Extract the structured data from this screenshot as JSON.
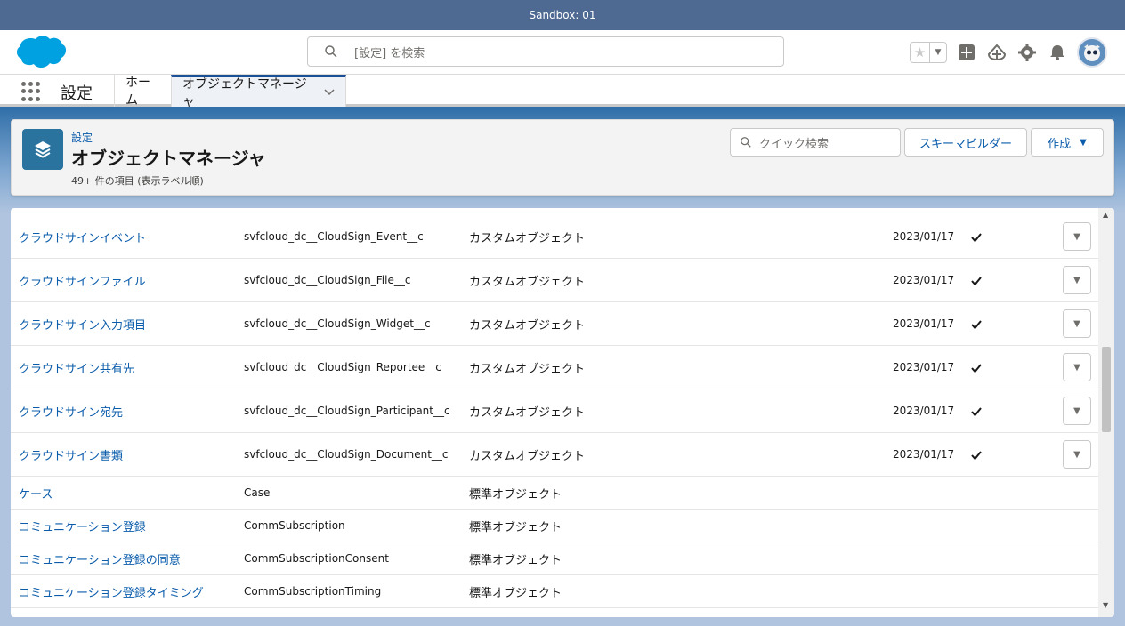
{
  "sandbox": {
    "label": "Sandbox: 01"
  },
  "header": {
    "search_placeholder": "[設定] を検索",
    "icons": [
      "salesforce-cloud-logo",
      "search-icon",
      "star-icon",
      "chevron-down-icon",
      "add-icon",
      "trailhead-icon",
      "gear-icon",
      "bell-icon",
      "avatar"
    ]
  },
  "nav": {
    "app_name": "設定",
    "tabs": [
      {
        "label": "ホーム"
      },
      {
        "label": "オブジェクトマネージャ"
      }
    ]
  },
  "page_header": {
    "breadcrumb": "設定",
    "title": "オブジェクトマネージャ",
    "count": "49+ 件の項目 (表示ラベル順)",
    "quick_search_placeholder": "クイック検索",
    "schema_builder_label": "スキーマビルダー",
    "create_label": "作成"
  },
  "rows": [
    {
      "label": "クラウドサインイベント",
      "api": "svfcloud_dc__CloudSign_Event__c",
      "type": "カスタムオブジェクト",
      "date": "2023/01/17",
      "deployed": true
    },
    {
      "label": "クラウドサインファイル",
      "api": "svfcloud_dc__CloudSign_File__c",
      "type": "カスタムオブジェクト",
      "date": "2023/01/17",
      "deployed": true
    },
    {
      "label": "クラウドサイン入力項目",
      "api": "svfcloud_dc__CloudSign_Widget__c",
      "type": "カスタムオブジェクト",
      "date": "2023/01/17",
      "deployed": true
    },
    {
      "label": "クラウドサイン共有先",
      "api": "svfcloud_dc__CloudSign_Reportee__c",
      "type": "カスタムオブジェクト",
      "date": "2023/01/17",
      "deployed": true
    },
    {
      "label": "クラウドサイン宛先",
      "api": "svfcloud_dc__CloudSign_Participant__c",
      "type": "カスタムオブジェクト",
      "date": "2023/01/17",
      "deployed": true
    },
    {
      "label": "クラウドサイン書類",
      "api": "svfcloud_dc__CloudSign_Document__c",
      "type": "カスタムオブジェクト",
      "date": "2023/01/17",
      "deployed": true
    },
    {
      "label": "ケース",
      "api": "Case",
      "type": "標準オブジェクト",
      "date": "",
      "deployed": false
    },
    {
      "label": "コミュニケーション登録",
      "api": "CommSubscription",
      "type": "標準オブジェクト",
      "date": "",
      "deployed": false
    },
    {
      "label": "コミュニケーション登録の同意",
      "api": "CommSubscriptionConsent",
      "type": "標準オブジェクト",
      "date": "",
      "deployed": false
    },
    {
      "label": "コミュニケーション登録タイミング",
      "api": "CommSubscriptionTiming",
      "type": "標準オブジェクト",
      "date": "",
      "deployed": false
    }
  ],
  "colors": {
    "brand": "#0b5cab",
    "sandbox_bar": "#4f6a92",
    "object_icon": "#2a739e"
  }
}
